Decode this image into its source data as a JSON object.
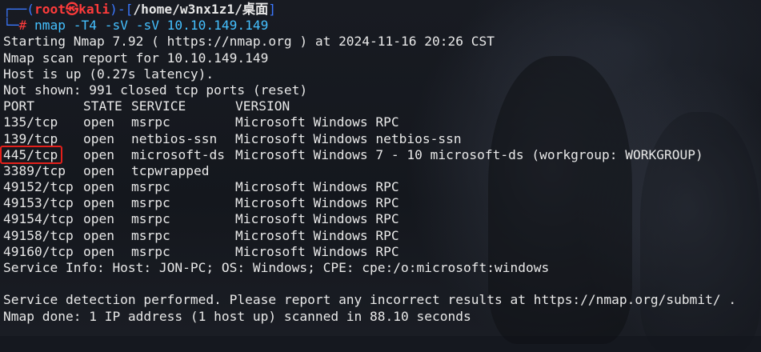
{
  "prompt": {
    "corner_top": "┌──(",
    "user": "root",
    "at_symbol": "㉿",
    "host": "kali",
    "sep": ")-[",
    "path": "/home/w3nx1z1/桌面",
    "close": "]",
    "corner_bottom": "└─",
    "hash": "#",
    "command": "nmap",
    "args": "-T4 -sV -sV 10.10.149.149"
  },
  "output": {
    "start_line": "Starting Nmap 7.92 ( https://nmap.org ) at 2024-11-16 20:26 CST",
    "report_line": "Nmap scan report for 10.10.149.149",
    "host_line": "Host is up (0.27s latency).",
    "not_shown_line": "Not shown: 991 closed tcp ports (reset)",
    "headers": {
      "port": "PORT",
      "state": "STATE",
      "service": "SERVICE",
      "version": "VERSION"
    },
    "rows": [
      {
        "port": "135/tcp",
        "state": "open",
        "service": "msrpc",
        "version": "Microsoft Windows RPC"
      },
      {
        "port": "139/tcp",
        "state": "open",
        "service": "netbios-ssn",
        "version": "Microsoft Windows netbios-ssn"
      },
      {
        "port": "445/tcp",
        "state": "open",
        "service": "microsoft-ds",
        "version": "Microsoft Windows 7 - 10 microsoft-ds (workgroup: WORKGROUP)"
      },
      {
        "port": "3389/tcp",
        "state": "open",
        "service": "tcpwrapped",
        "version": ""
      },
      {
        "port": "49152/tcp",
        "state": "open",
        "service": "msrpc",
        "version": "Microsoft Windows RPC"
      },
      {
        "port": "49153/tcp",
        "state": "open",
        "service": "msrpc",
        "version": "Microsoft Windows RPC"
      },
      {
        "port": "49154/tcp",
        "state": "open",
        "service": "msrpc",
        "version": "Microsoft Windows RPC"
      },
      {
        "port": "49158/tcp",
        "state": "open",
        "service": "msrpc",
        "version": "Microsoft Windows RPC"
      },
      {
        "port": "49160/tcp",
        "state": "open",
        "service": "msrpc",
        "version": "Microsoft Windows RPC"
      }
    ],
    "service_info_line": "Service Info: Host: JON-PC; OS: Windows; CPE: cpe:/o:microsoft:windows",
    "detection_line": "Service detection performed. Please report any incorrect results at https://nmap.org/submit/ .",
    "done_line": "Nmap done: 1 IP address (1 host up) scanned in 88.10 seconds"
  },
  "colors": {
    "background": "#15181f",
    "text": "#e8e8e8",
    "prompt_blue": "#3b78ff",
    "prompt_red": "#ff3b3b",
    "command_cyan": "#45c0ff",
    "highlight_box": "#e3201b"
  },
  "highlight": {
    "row_index": 2
  }
}
